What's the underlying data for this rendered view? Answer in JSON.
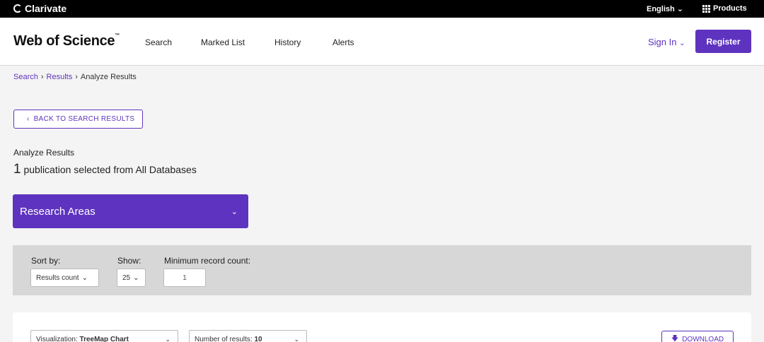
{
  "topbar": {
    "brand": "Clarivate",
    "language": "English",
    "products": "Products"
  },
  "header": {
    "logo": "Web of Science",
    "logo_tm": "™",
    "nav": [
      "Search",
      "Marked List",
      "History",
      "Alerts"
    ],
    "sign_in": "Sign In",
    "register": "Register"
  },
  "breadcrumb": {
    "items": [
      "Search",
      "Results"
    ],
    "current": "Analyze Results"
  },
  "back_button": "BACK TO SEARCH RESULTS",
  "analyze": {
    "label": "Analyze Results",
    "count": "1",
    "summary": "publication selected from All Databases"
  },
  "field_dropdown": {
    "selected": "Research Areas"
  },
  "filters": {
    "sort_label": "Sort by:",
    "sort_value": "Results count",
    "show_label": "Show:",
    "show_value": "25",
    "min_label": "Minimum record count:",
    "min_value": "1"
  },
  "visualization": {
    "type_label": "Visualization:",
    "type_value": "TreeMap Chart",
    "results_label": "Number of results:",
    "results_value": "10",
    "download": "DOWNLOAD"
  },
  "colors": {
    "accent": "#5e33bf",
    "topbar": "#000000",
    "filterbar": "#d7d7d7"
  }
}
